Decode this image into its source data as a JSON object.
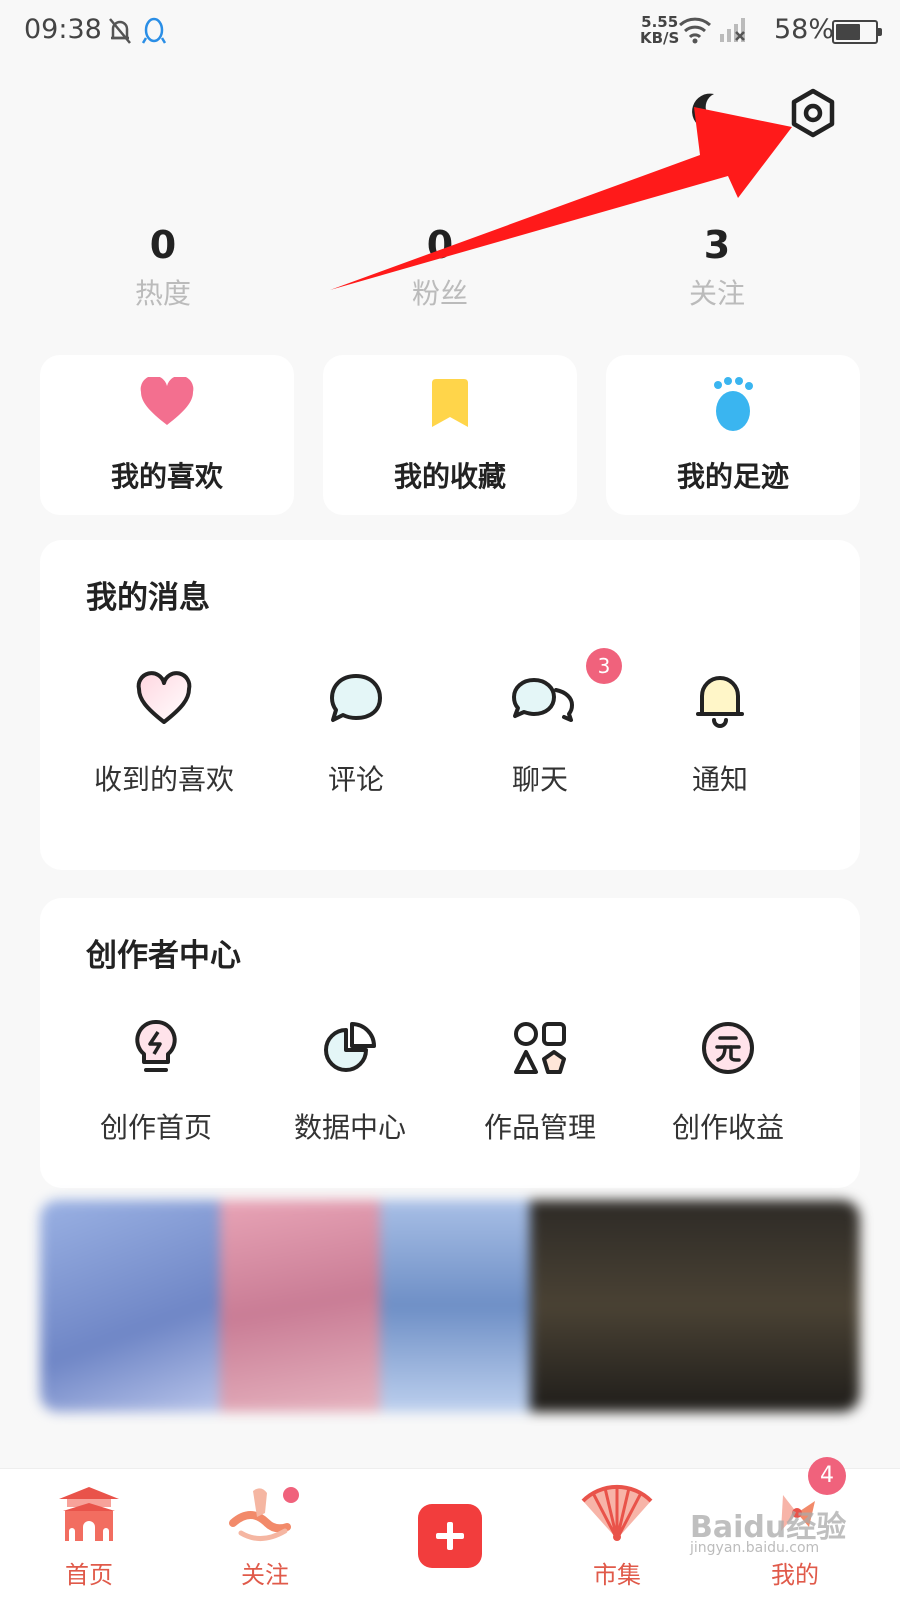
{
  "status_bar": {
    "time": "09:38",
    "net_speed": "5.55",
    "net_unit": "KB/S",
    "battery_percent": "58%",
    "battery_level": 0.58
  },
  "top": {
    "night_mode_icon": "moon-icon",
    "settings_icon": "settings-icon"
  },
  "stats": [
    {
      "value": "0",
      "label": "热度"
    },
    {
      "value": "0",
      "label": "粉丝"
    },
    {
      "value": "3",
      "label": "关注"
    }
  ],
  "quick_cards": [
    {
      "label": "我的喜欢",
      "icon": "heart-icon",
      "color": "#f36f8f"
    },
    {
      "label": "我的收藏",
      "icon": "bookmark-icon",
      "color": "#ffd54a"
    },
    {
      "label": "我的足迹",
      "icon": "footprint-icon",
      "color": "#3ab5f0"
    }
  ],
  "messages": {
    "title": "我的消息",
    "items": [
      {
        "label": "收到的喜欢",
        "icon": "heart-outline-icon"
      },
      {
        "label": "评论",
        "icon": "comment-icon"
      },
      {
        "label": "聊天",
        "icon": "chat-icon",
        "badge": "3"
      },
      {
        "label": "通知",
        "icon": "bell-icon"
      }
    ]
  },
  "creator": {
    "title": "创作者中心",
    "items": [
      {
        "label": "创作首页",
        "icon": "bulb-icon"
      },
      {
        "label": "数据中心",
        "icon": "pie-chart-icon"
      },
      {
        "label": "作品管理",
        "icon": "shapes-icon"
      },
      {
        "label": "创作收益",
        "icon": "yuan-icon"
      }
    ]
  },
  "bottom_nav": [
    {
      "label": "首页",
      "icon": "home-palace-icon"
    },
    {
      "label": "关注",
      "icon": "follow-icon"
    },
    {
      "label": "",
      "icon": "plus-icon"
    },
    {
      "label": "市集",
      "icon": "fan-market-icon"
    },
    {
      "label": "我的",
      "icon": "profile-icon",
      "badge": "4"
    }
  ],
  "watermark": {
    "brand": "Baidu经验",
    "url": "jingyan.baidu.com"
  },
  "colors": {
    "accent": "#f23d3d",
    "badge": "#f0627c",
    "nav_label": "#e05a4a",
    "arrow": "#ff1a1a"
  }
}
